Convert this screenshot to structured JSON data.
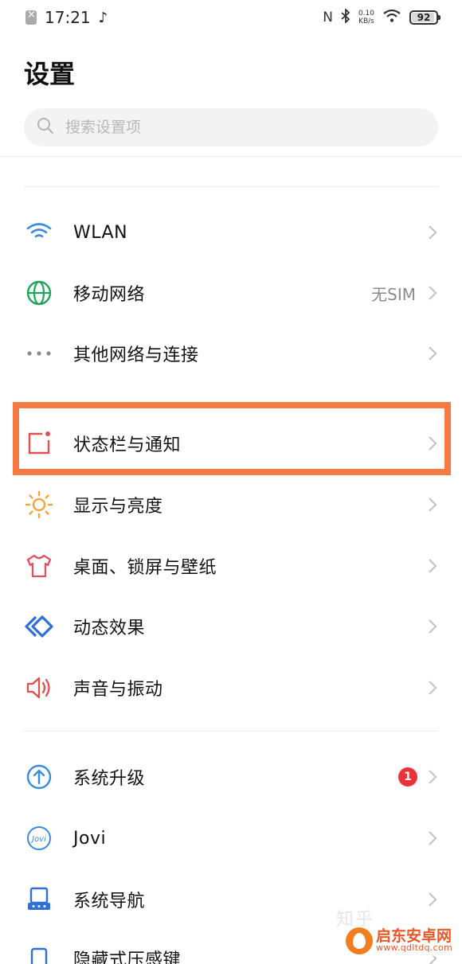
{
  "status_bar": {
    "time": "17:21",
    "network_speed_value": "0.10",
    "network_speed_unit": "KB/s",
    "battery": "92",
    "battery_level": 0.92
  },
  "header": {
    "title": "设置"
  },
  "search": {
    "placeholder": "搜索设置项",
    "value": ""
  },
  "settings": {
    "wlan": {
      "label": "WLAN",
      "icon": "wifi-icon"
    },
    "mobile_network": {
      "label": "移动网络",
      "value": "无SIM",
      "icon": "globe-icon"
    },
    "other_network": {
      "label": "其他网络与连接",
      "icon": "more-dots-icon"
    },
    "status_bar_notifications": {
      "label": "状态栏与通知",
      "icon": "notification-square-icon"
    },
    "display_brightness": {
      "label": "显示与亮度",
      "icon": "sun-icon"
    },
    "desktop_lockscreen_wallpaper": {
      "label": "桌面、锁屏与壁纸",
      "icon": "tshirt-icon"
    },
    "dynamic_effects": {
      "label": "动态效果",
      "icon": "diamond-icon"
    },
    "sound_vibration": {
      "label": "声音与振动",
      "icon": "speaker-icon"
    },
    "system_upgrade": {
      "label": "系统升级",
      "badge": "1",
      "icon": "upgrade-arrow-icon"
    },
    "jovi": {
      "label": "Jovi",
      "icon": "jovi-icon"
    },
    "system_navigation": {
      "label": "系统导航",
      "icon": "navigation-device-icon"
    },
    "hidden_pressure_keys": {
      "label": "隐藏式压感键",
      "icon": "pressure-key-icon"
    }
  },
  "watermark": {
    "name": "启东安卓网",
    "url": "www.qdltdq.com",
    "faint_text": "知乎"
  },
  "colors": {
    "highlight_border": "#f57a43",
    "badge_red": "#e8333b",
    "wifi_blue": "#3b8be0",
    "globe_green": "#1fa55b",
    "status_red": "#e0504e",
    "sun_orange": "#f5a33a",
    "tshirt_red": "#e05262",
    "diamond_blue": "#2f6fd6",
    "speaker_red": "#e0504e",
    "upgrade_blue": "#3b8be0"
  }
}
